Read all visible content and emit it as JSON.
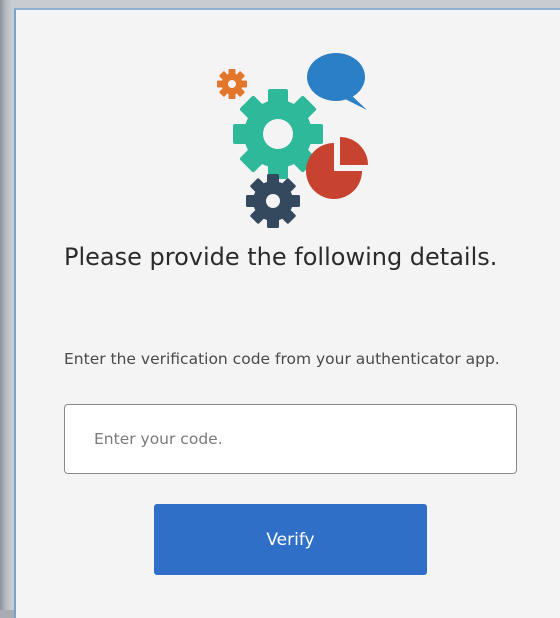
{
  "dialog": {
    "heading": "Please provide the following details.",
    "instruction": "Enter the verification code from your authenticator app.",
    "code_input": {
      "placeholder": "Enter your code.",
      "value": ""
    },
    "verify_label": "Verify"
  },
  "illustration": {
    "icons": [
      "small-gear-icon",
      "speech-bubble-icon",
      "large-gear-icon",
      "pie-chart-icon",
      "dark-gear-icon"
    ],
    "colors": {
      "small_gear": "#e2762a",
      "speech_bubble": "#2b7fc4",
      "large_gear": "#2db99a",
      "pie_chart": "#c8432f",
      "dark_gear": "#34495e"
    }
  },
  "colors": {
    "panel_background": "#f4f4f4",
    "button": "#2f6fc8",
    "button_text": "#ffffff"
  }
}
